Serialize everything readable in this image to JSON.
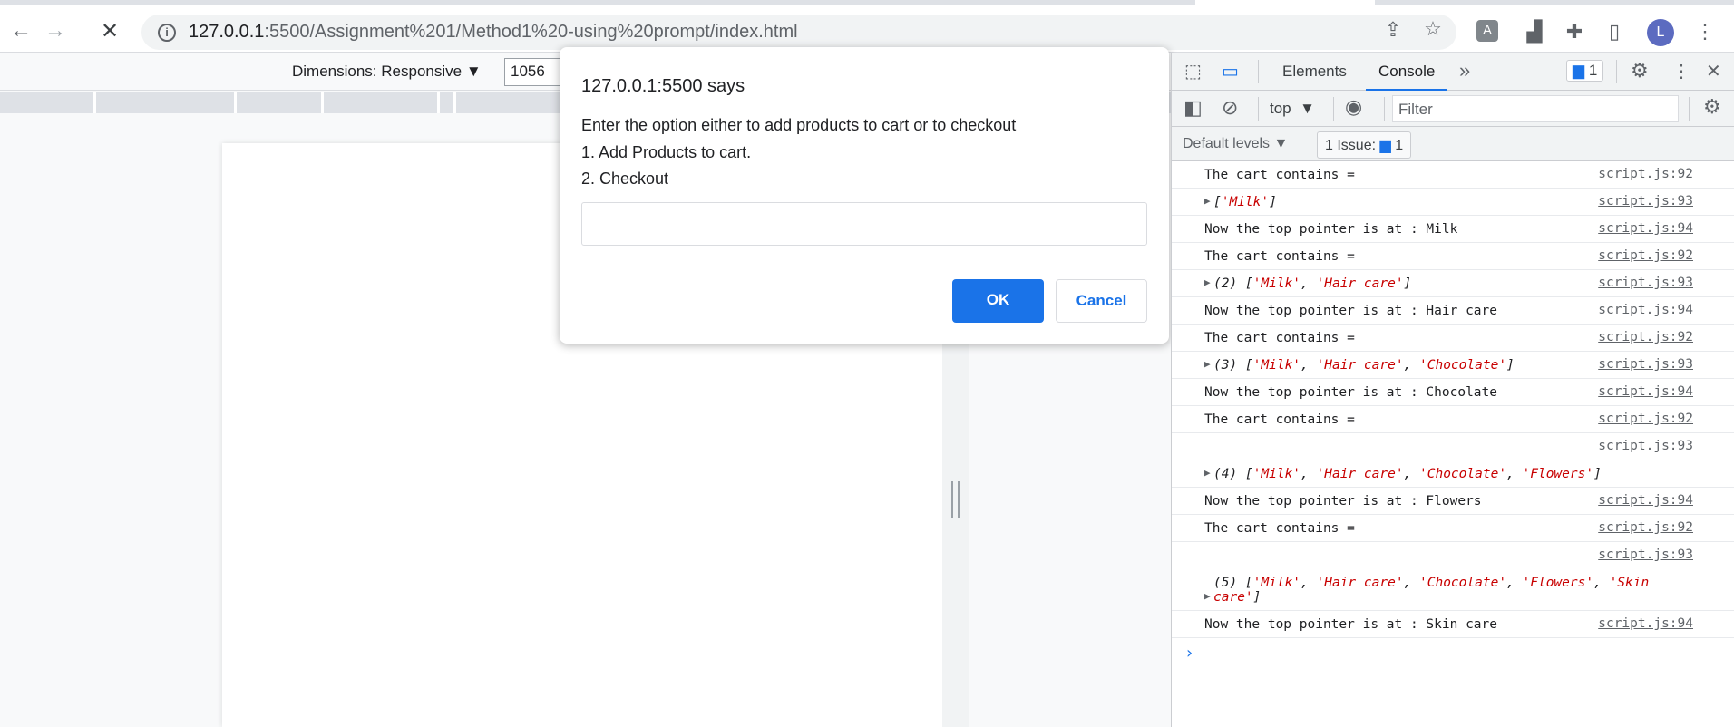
{
  "browser": {
    "url_host": "127.0.0.1",
    "url_rest": ":5500/Assignment%201/Method1%20-using%20prompt/index.html",
    "avatar": "L"
  },
  "device_toolbar": {
    "dimensions_label": "Dimensions: Responsive",
    "width_value": "1056"
  },
  "dialog": {
    "title": "127.0.0.1:5500 says",
    "lines": [
      "Enter the option either to add products to cart or to checkout",
      "1. Add Products to cart.",
      "2. Checkout"
    ],
    "input_value": "",
    "ok": "OK",
    "cancel": "Cancel"
  },
  "devtools": {
    "tabs": [
      "Elements",
      "Console"
    ],
    "active_tab": "Console",
    "message_count": "1",
    "context": "top",
    "filter_placeholder": "Filter",
    "levels": "Default levels",
    "issues_label": "1 Issue:",
    "issues_count": "1",
    "console": [
      {
        "type": "text",
        "msg": "The cart contains =",
        "src": "script.js:92"
      },
      {
        "type": "array",
        "prefix": "",
        "items": [
          "'Milk'"
        ],
        "src": "script.js:93"
      },
      {
        "type": "text",
        "msg": "Now the top pointer is at : Milk",
        "src": "script.js:94"
      },
      {
        "type": "text",
        "msg": "The cart contains =",
        "src": "script.js:92"
      },
      {
        "type": "array",
        "prefix": "(2) ",
        "items": [
          "'Milk'",
          "'Hair care'"
        ],
        "src": "script.js:93"
      },
      {
        "type": "text",
        "msg": "Now the top pointer is at : Hair care",
        "src": "script.js:94"
      },
      {
        "type": "text",
        "msg": "The cart contains =",
        "src": "script.js:92"
      },
      {
        "type": "array",
        "prefix": "(3) ",
        "items": [
          "'Milk'",
          "'Hair care'",
          "'Chocolate'"
        ],
        "src": "script.js:93"
      },
      {
        "type": "text",
        "msg": "Now the top pointer is at : Chocolate",
        "src": "script.js:94"
      },
      {
        "type": "text",
        "msg": "The cart contains =",
        "src": "script.js:92"
      },
      {
        "type": "array",
        "prefix": "(4) ",
        "items": [
          "'Milk'",
          "'Hair care'",
          "'Chocolate'",
          "'Flowers'"
        ],
        "src": "script.js:93",
        "h": 60
      },
      {
        "type": "text",
        "msg": "Now the top pointer is at : Flowers",
        "src": "script.js:94"
      },
      {
        "type": "text",
        "msg": "The cart contains =",
        "src": "script.js:92"
      },
      {
        "type": "array",
        "prefix": "(5) ",
        "items": [
          "'Milk'",
          "'Hair care'",
          "'Chocolate'",
          "'Flowers'",
          "'Skin care'"
        ],
        "src": "script.js:93",
        "h": 76
      },
      {
        "type": "text",
        "msg": "Now the top pointer is at : Skin care",
        "src": "script.js:94"
      }
    ],
    "prompt": "›"
  }
}
